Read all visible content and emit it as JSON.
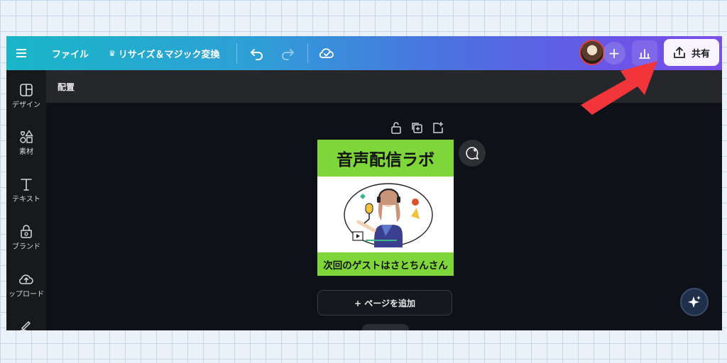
{
  "topbar": {
    "file_label": "ファイル",
    "resize_label": "リサイズ＆マジック変換",
    "share_label": "共有"
  },
  "sidebar": {
    "items": [
      {
        "label": "デザイン",
        "icon": "design-icon"
      },
      {
        "label": "素材",
        "icon": "elements-icon"
      },
      {
        "label": "テキスト",
        "icon": "text-icon"
      },
      {
        "label": "ブランド",
        "icon": "brand-icon"
      },
      {
        "label": "ップロード",
        "icon": "upload-icon"
      }
    ]
  },
  "subbar": {
    "label": "配置"
  },
  "design": {
    "title": "音声配信ラボ",
    "subtitle": "次回のゲストはさとちんさん",
    "accent_color": "#7ed63b"
  },
  "canvas": {
    "add_page_label": "+ ページを追加"
  },
  "colors": {
    "arrow": "#f2353b",
    "share_bg": "#f7f3ff"
  }
}
